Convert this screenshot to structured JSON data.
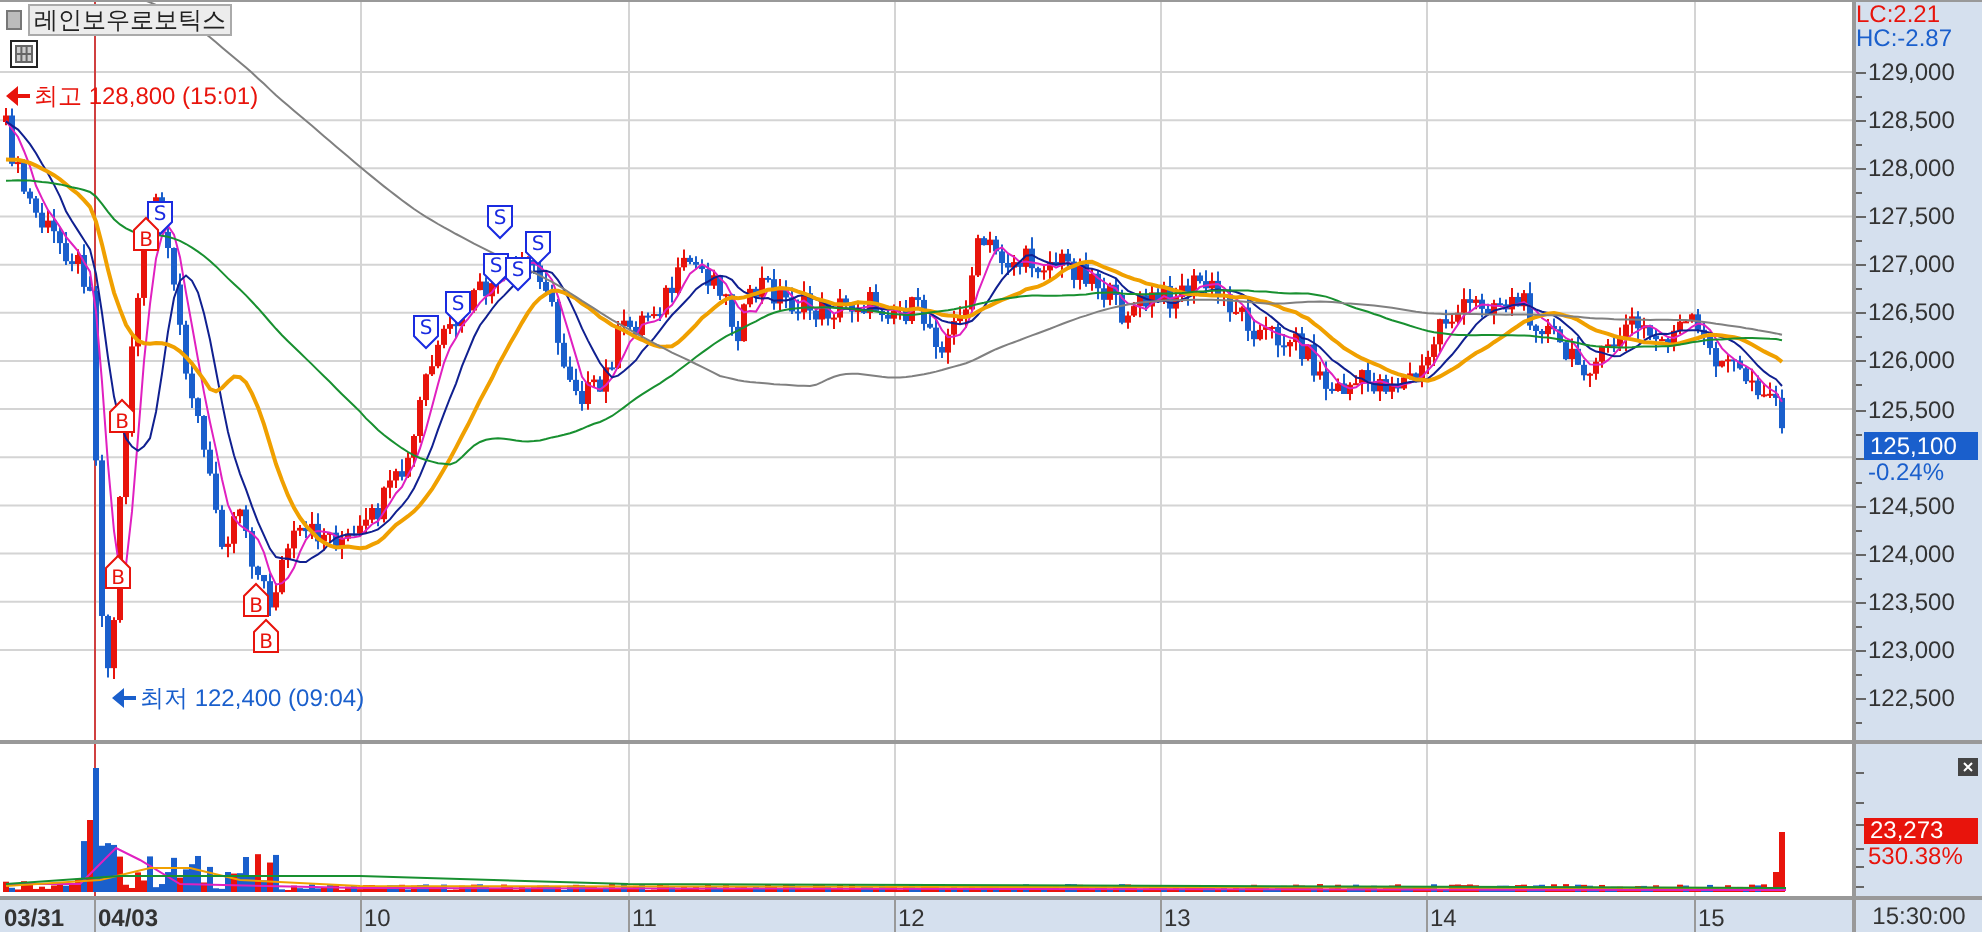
{
  "title": "레인보우로보틱스",
  "indicators": [
    {
      "label": "LC:2.21",
      "kind": "up"
    },
    {
      "label": "HC:-2.87",
      "kind": "down"
    }
  ],
  "price_axis": {
    "ticks": [
      "129,000",
      "128,500",
      "128,000",
      "127,500",
      "127,000",
      "126,500",
      "126,000",
      "125,500",
      "124,500",
      "124,000",
      "123,500",
      "123,000",
      "122,500"
    ]
  },
  "current_price": {
    "value": "125,100",
    "change": "-0.24%"
  },
  "high_label": {
    "text": "최고 128,800 (15:01)",
    "kind": "high"
  },
  "low_label": {
    "text": "최저 122,400 (09:04)",
    "kind": "low"
  },
  "signals": [
    {
      "label": "S",
      "kind": "sell"
    },
    {
      "label": "B",
      "kind": "buy"
    },
    {
      "label": "B",
      "kind": "buy"
    },
    {
      "label": "B",
      "kind": "buy"
    },
    {
      "label": "B",
      "kind": "buy"
    },
    {
      "label": "B",
      "kind": "buy"
    },
    {
      "label": "S",
      "kind": "sell"
    },
    {
      "label": "S",
      "kind": "sell"
    },
    {
      "label": "S",
      "kind": "sell"
    },
    {
      "label": "S",
      "kind": "sell"
    },
    {
      "label": "S",
      "kind": "sell"
    },
    {
      "label": "S",
      "kind": "sell"
    }
  ],
  "volume": {
    "value": "23,273",
    "change": "530.38%"
  },
  "dates": [
    {
      "label": "03/31",
      "bold": true
    },
    {
      "label": "04/03",
      "bold": true
    },
    {
      "label": "10",
      "bold": false
    },
    {
      "label": "11",
      "bold": false
    },
    {
      "label": "12",
      "bold": false
    },
    {
      "label": "13",
      "bold": false
    },
    {
      "label": "14",
      "bold": false
    },
    {
      "label": "15",
      "bold": false
    }
  ],
  "time": "15:30:00"
}
